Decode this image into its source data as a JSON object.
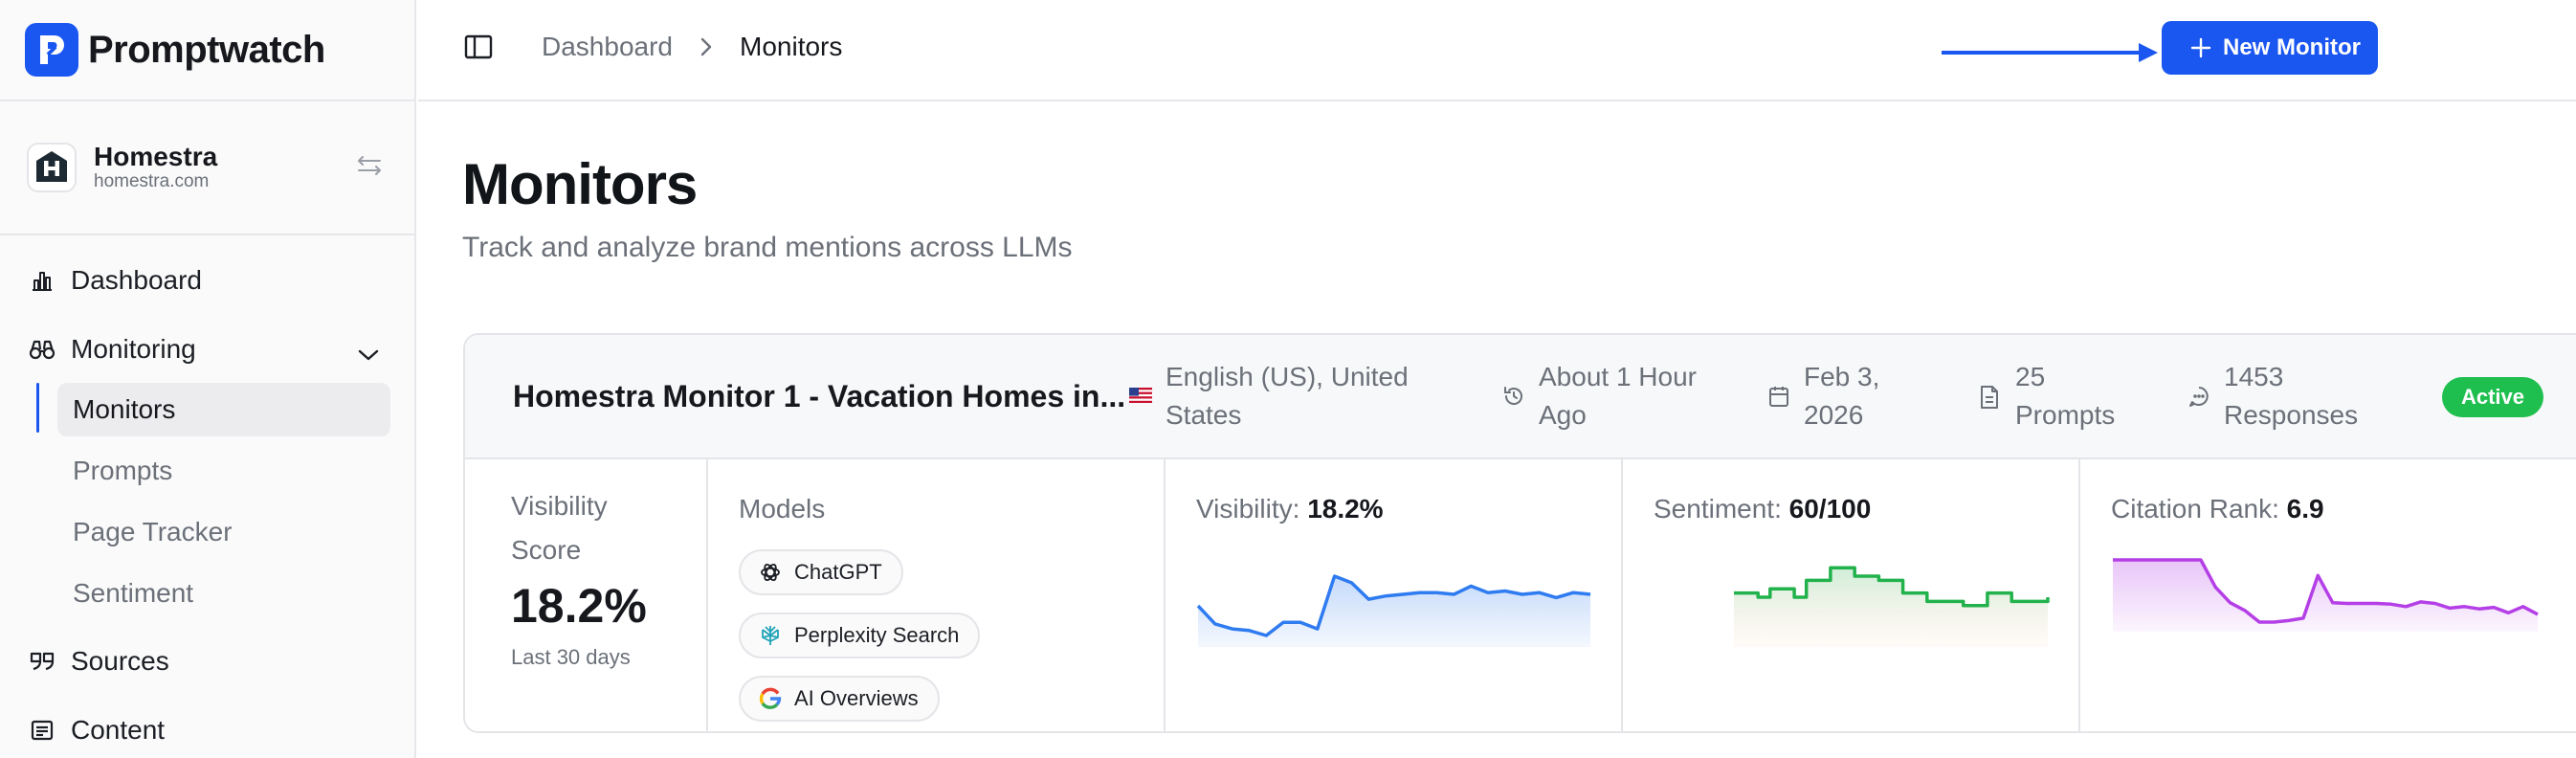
{
  "brand": {
    "name": "Promptwatch",
    "logo_icon": "promptwatch-logo-icon"
  },
  "account": {
    "name": "Homestra",
    "domain": "homestra.com",
    "switch_icon": "swap-arrows-icon"
  },
  "nav": {
    "dashboard": "Dashboard",
    "monitoring": "Monitoring",
    "sub": [
      "Monitors",
      "Prompts",
      "Page Tracker",
      "Sentiment"
    ],
    "sources": "Sources",
    "content": "Content"
  },
  "header": {
    "breadcrumb": [
      "Dashboard",
      "Monitors"
    ],
    "new_button": "New Monitor"
  },
  "page": {
    "title": "Monitors",
    "subtitle": "Track and analyze brand mentions across LLMs"
  },
  "monitor": {
    "title": "Homestra Monitor 1 - Vacation Homes in...",
    "locale": [
      "English (US), United",
      "States"
    ],
    "updated": [
      "About 1 Hour",
      "Ago"
    ],
    "date": [
      "Feb 3,",
      "2026"
    ],
    "prompts": [
      "25",
      "Prompts"
    ],
    "responses": [
      "1453",
      "Responses"
    ],
    "status": "Active",
    "visibility_score": {
      "label": [
        "Visibility",
        "Score"
      ],
      "value": "18.2%",
      "period": "Last 30 days"
    },
    "models": {
      "label": "Models",
      "items": [
        "ChatGPT",
        "Perplexity Search",
        "AI Overviews"
      ]
    },
    "visibility": {
      "label": "Visibility:",
      "value": "18.2%"
    },
    "sentiment": {
      "label": "Sentiment:",
      "value": "60/100"
    },
    "citation_rank": {
      "label": "Citation Rank:",
      "value": "6.9"
    }
  },
  "colors": {
    "primary": "#1a56f0",
    "active_badge": "#1fbf4f",
    "visibility_line": "#2f7bf0",
    "sentiment_line": "#22b24c",
    "citation_line": "#b43fe6"
  },
  "sparklines": {
    "visibility": [
      50,
      28,
      22,
      20,
      14,
      30,
      30,
      22,
      86,
      78,
      58,
      62,
      64,
      66,
      66,
      64,
      74,
      66,
      68,
      64,
      66,
      60,
      66,
      64
    ],
    "sentiment": [
      62,
      62,
      60,
      64,
      64,
      60,
      68,
      68,
      74,
      74,
      70,
      70,
      68,
      68,
      62,
      62,
      58,
      58,
      58,
      56,
      56,
      62,
      62,
      58,
      58,
      58,
      60
    ],
    "citation_rank": [
      2,
      2,
      2,
      2,
      2,
      2,
      2,
      5.5,
      7.5,
      8.5,
      10,
      10,
      9.8,
      9.5,
      4,
      7.5,
      7.6,
      7.6,
      7.6,
      7.7,
      8,
      7.4,
      7.6,
      8.2,
      8,
      8.3,
      8.1,
      8.8,
      8,
      9
    ]
  }
}
